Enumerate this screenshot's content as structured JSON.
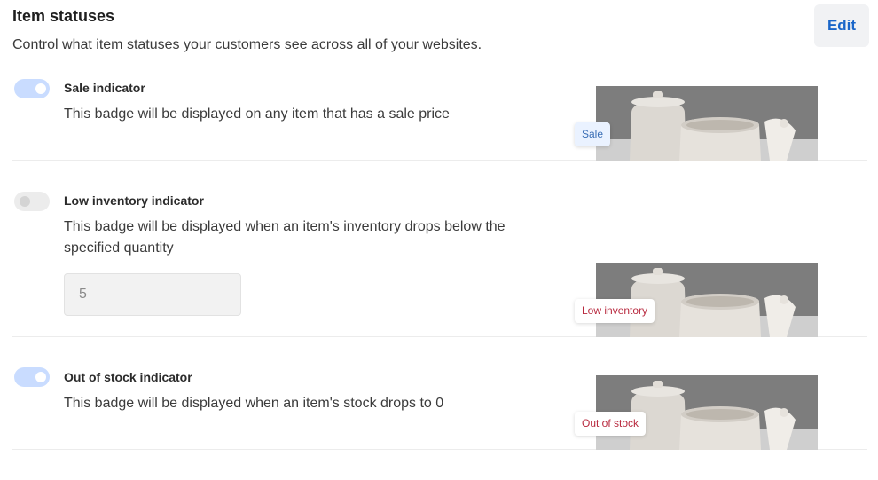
{
  "header": {
    "title": "Item statuses",
    "subtitle": "Control what item statuses your customers see across all of your websites.",
    "edit_label": "Edit"
  },
  "rows": [
    {
      "title": "Sale indicator",
      "description": "This badge will be displayed on any item that has a sale price",
      "enabled": true,
      "badge": "Sale"
    },
    {
      "title": "Low inventory indicator",
      "description": "This badge will be displayed when an item's inventory drops below the specified quantity",
      "enabled": false,
      "quantity": "5",
      "badge": "Low inventory"
    },
    {
      "title": "Out of stock indicator",
      "description": "This badge will be displayed when an item's stock drops to 0",
      "enabled": true,
      "badge": "Out of stock"
    }
  ],
  "colors": {
    "accent": "#1a66c9",
    "toggle_on": "#c9dcff",
    "toggle_off": "#ececec",
    "badge_red": "#b8293e",
    "badge_blue": "#3b6fb6"
  },
  "icons": {
    "product_image": "ceramic-jars-image"
  }
}
